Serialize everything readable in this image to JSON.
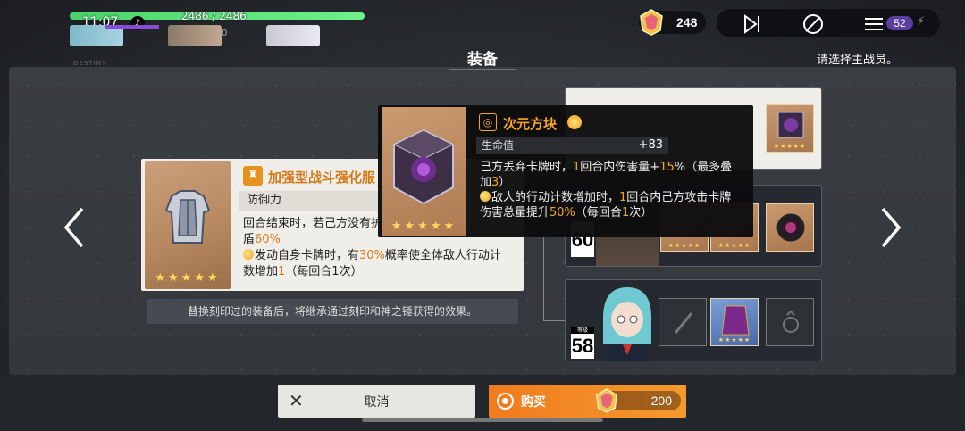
{
  "hud": {
    "clock": "11:07",
    "hp_text": "2486 / 2486",
    "hp_fraction": 1.0,
    "member2_stat": "0",
    "coins": "248",
    "deck_count": "52"
  },
  "header": {
    "title": "装备",
    "hint": "请选择主战员。",
    "tiny_label": "DESTINY"
  },
  "left_card": {
    "name": "加强型战斗强化服",
    "stars": "★★★★★",
    "stat_label": "防御力",
    "desc_line1": "回合结束时，若己方没有护",
    "desc_line2a": "盾",
    "desc_line2b": "60%",
    "desc_line3a": "发动自身卡牌时，有",
    "desc_line3b": "30%",
    "desc_line3c": "概率使全体敌人行动计",
    "desc_line4a": "数增加",
    "desc_line4b": "1",
    "desc_line4c": "（每回合1次）"
  },
  "note": "替换刻印过的装备后，将继承通过刻印和神之锤获得的效果。",
  "tooltip": {
    "name": "次元方块",
    "stars": "★★★★★",
    "stat_label": "生命值",
    "stat_value": "+83",
    "l1a": "己方丢弃卡牌时，",
    "l1b": "1",
    "l1c": "回合内伤害量+",
    "l1d": "15",
    "l1e": "%（最多叠",
    "l2a": "加",
    "l2b": "3",
    "l2c": "）",
    "l3a": "敌人的行动计数增加时，",
    "l3b": "1",
    "l3c": "回合内己方攻击卡牌",
    "l4a": "伤害总量提升",
    "l4b": "50%",
    "l4c": "（每回合",
    "l4d": "1",
    "l4e": "次）"
  },
  "team": {
    "mid_level": "60",
    "bot_level": "58",
    "level_label": "等级",
    "mini_stars": "★★★★★"
  },
  "buttons": {
    "cancel": "取消",
    "buy": "购买",
    "price": "200"
  }
}
